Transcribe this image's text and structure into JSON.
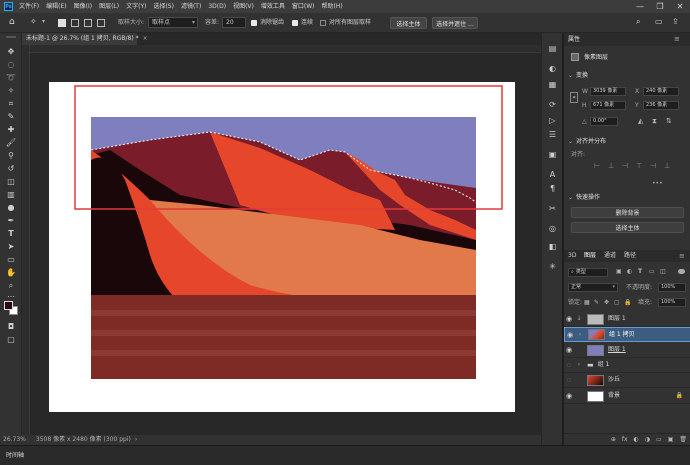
{
  "menubar": {
    "logo": "Ps",
    "items": [
      "文件(F)",
      "编辑(E)",
      "图像(I)",
      "图层(L)",
      "文字(Y)",
      "选择(S)",
      "滤镜(T)",
      "3D(D)",
      "视图(V)",
      "增效工具",
      "窗口(W)",
      "帮助(H)"
    ],
    "win_controls": [
      "—",
      "❐",
      "✕"
    ]
  },
  "options": {
    "sample_size_label": "取样大小:",
    "sample_size_value": "取样点",
    "tolerance_label": "容差:",
    "tolerance_value": "20",
    "antialias_label": "消除锯齿",
    "contiguous_label": "连续",
    "all_layers_label": "对所有图层取样",
    "select_subject": "选择主体",
    "select_mask": "选择并遮住 ..."
  },
  "tab": {
    "title": "未标题-1 @ 26.7% (组 1 拷贝, RGB/8) *",
    "close": "×"
  },
  "status": {
    "zoom": "26.73%",
    "info": "3508 像素 x 2480 像素 (300 ppi)",
    "more": "›"
  },
  "timeline_label": "时间轴",
  "properties": {
    "header": "属性",
    "subheader": "像素图层",
    "transform_title": "变换",
    "w_label": "W",
    "w_value": "3039 像素",
    "x_label": "X",
    "x_value": "240 像素",
    "h_label": "H",
    "h_value": "671 像素",
    "y_label": "Y",
    "y_value": "236 像素",
    "angle_label": "△",
    "angle_value": "0.00°",
    "align_title": "对齐并分布",
    "align_label": "对齐:",
    "quick_title": "快速操作",
    "remove_bg": "删除背景",
    "select_subject": "选择主体",
    "more": "•••"
  },
  "layers_panel": {
    "tabs": [
      "3D",
      "图层",
      "通道",
      "路径"
    ],
    "kind_label": "类型",
    "blend_mode": "正常",
    "opacity_label": "不透明度:",
    "opacity_value": "100%",
    "lock_label": "锁定:",
    "fill_label": "填充:",
    "fill_value": "100%",
    "layers": [
      {
        "name": "图层 1"
      },
      {
        "name": "组 1 拷贝"
      },
      {
        "name": "图层 1"
      },
      {
        "name": "组 1"
      },
      {
        "name": "沙丘"
      },
      {
        "name": "背景"
      }
    ],
    "footer_icons": [
      "⊕",
      "fx",
      "◐",
      "◑",
      "▭",
      "▣",
      "🗑"
    ]
  },
  "colors": {
    "sky": "#7f7fc0",
    "dune_dark": "#1a070a",
    "dune_maroon": "#7a1c2a",
    "dune_red": "#e6472a",
    "dune_orange": "#e2794a",
    "ground": "#7d2b24",
    "highlight": "#3c5c80",
    "red_rect": "#e03a3a"
  }
}
